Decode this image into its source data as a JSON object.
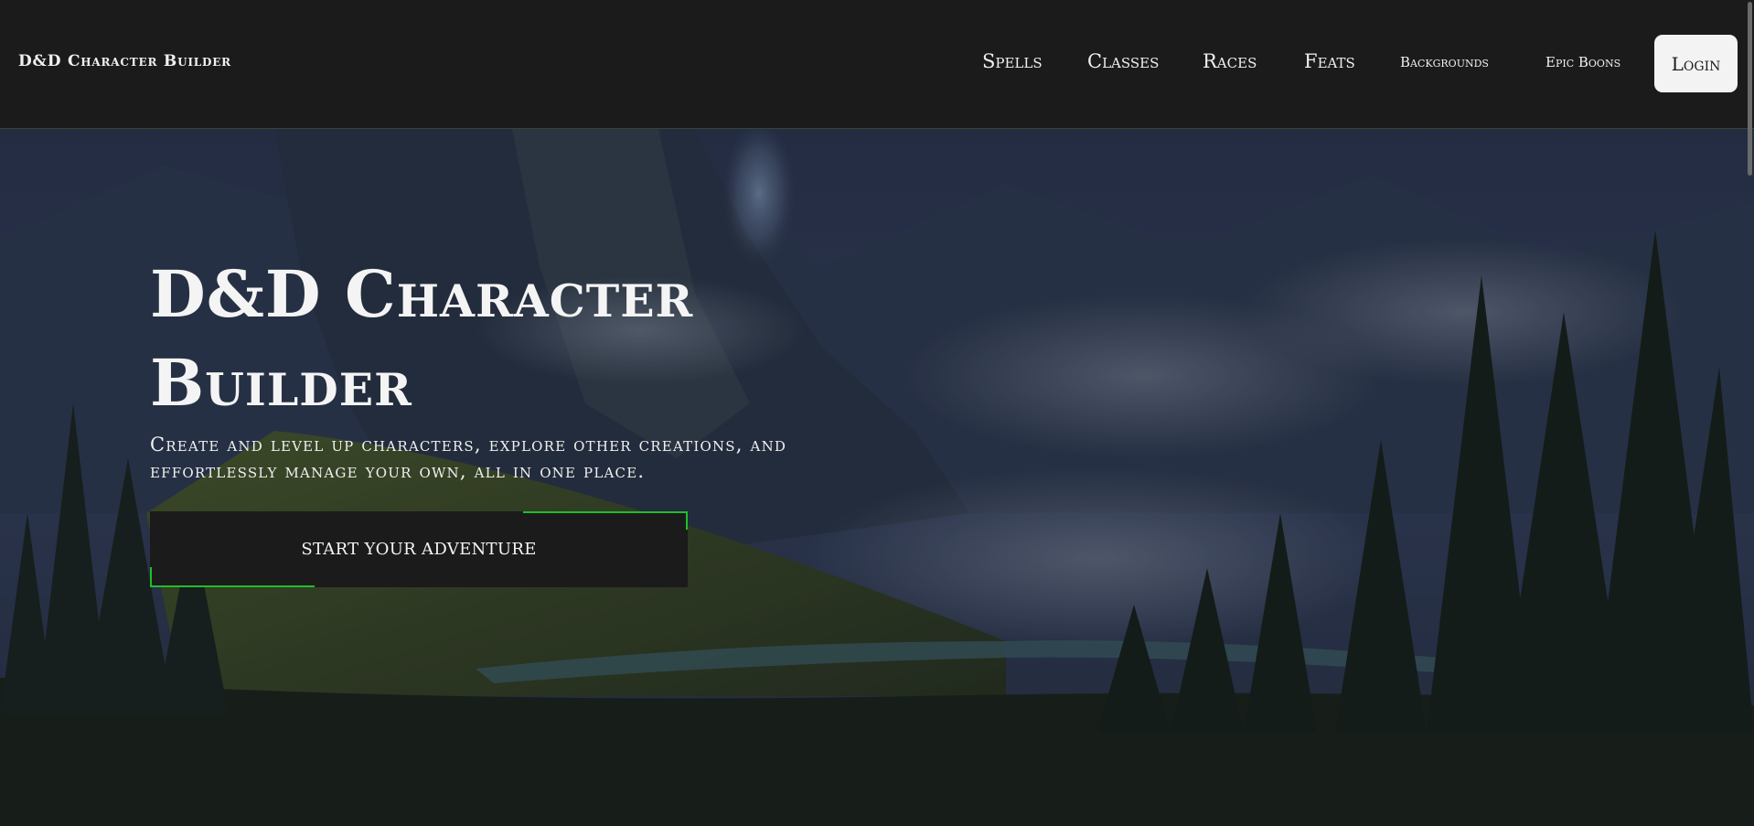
{
  "header": {
    "brand": "D&D Character Builder",
    "nav": {
      "spells": "Spells",
      "classes": "Classes",
      "races": "Races",
      "feats": "Feats",
      "backgrounds": "Backgrounds",
      "epic_boons": "Epic Boons"
    },
    "login": "Login"
  },
  "hero": {
    "title": "D&D Character Builder",
    "subtitle": "Create and level up characters, explore other creations, and effortlessly manage your own, all in one place.",
    "cta": "START YOUR ADVENTURE"
  },
  "colors": {
    "header_bg": "#1b1b1b",
    "accent": "#1dbf2a",
    "login_bg": "#f3f3f3"
  }
}
